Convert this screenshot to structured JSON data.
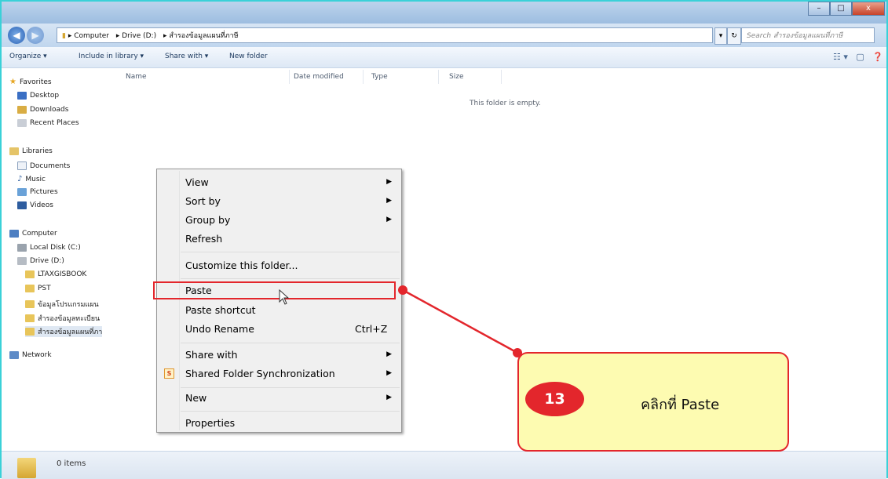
{
  "window": {
    "title": "",
    "buttons": {
      "minimize": "–",
      "maximize": "□",
      "close": "x"
    }
  },
  "address_bar": {
    "segments": [
      "Computer",
      "Drive (D:)",
      "สำรองข้อมูลแผนที่ภาษี"
    ],
    "search_placeholder": "Search สำรองข้อมูลแผนที่ภาษี"
  },
  "toolbar": {
    "organize": "Organize ▾",
    "include_in_library": "Include in library ▾",
    "share_with": "Share with ▾",
    "new_folder": "New folder"
  },
  "sidebar": {
    "favorites": {
      "label": "Favorites",
      "items": [
        "Desktop",
        "Downloads",
        "Recent Places"
      ]
    },
    "libraries": {
      "label": "Libraries",
      "items": [
        "Documents",
        "Music",
        "Pictures",
        "Videos"
      ]
    },
    "computer": {
      "label": "Computer",
      "items": [
        "Local Disk (C:)",
        "Drive (D:)"
      ]
    },
    "drive_folders": [
      "LTAXGISBOOK",
      "PST",
      "ข้อมูลโปรแกรมแผน",
      "สำรองข้อมูลทะเบียน",
      "สำรองข้อมูลแผนที่ภา"
    ],
    "network": "Network"
  },
  "columns": {
    "name": "Name",
    "date_modified": "Date modified",
    "type": "Type",
    "size": "Size"
  },
  "empty_message": "This folder is empty.",
  "status": {
    "items": "0 items"
  },
  "context_menu": {
    "view": "View",
    "sort_by": "Sort by",
    "group_by": "Group by",
    "refresh": "Refresh",
    "customize": "Customize this folder...",
    "paste": "Paste",
    "paste_shortcut": "Paste shortcut",
    "undo_rename": "Undo Rename",
    "undo_shortcut": "Ctrl+Z",
    "share_with": "Share with",
    "shared_sync": "Shared Folder Synchronization",
    "shared_sync_icon": "S",
    "new": "New",
    "properties": "Properties"
  },
  "annotation": {
    "step": "13",
    "text": "คลิกที่   Paste",
    "color": "#e3262c",
    "callout_bg": "#fdfbb1"
  }
}
